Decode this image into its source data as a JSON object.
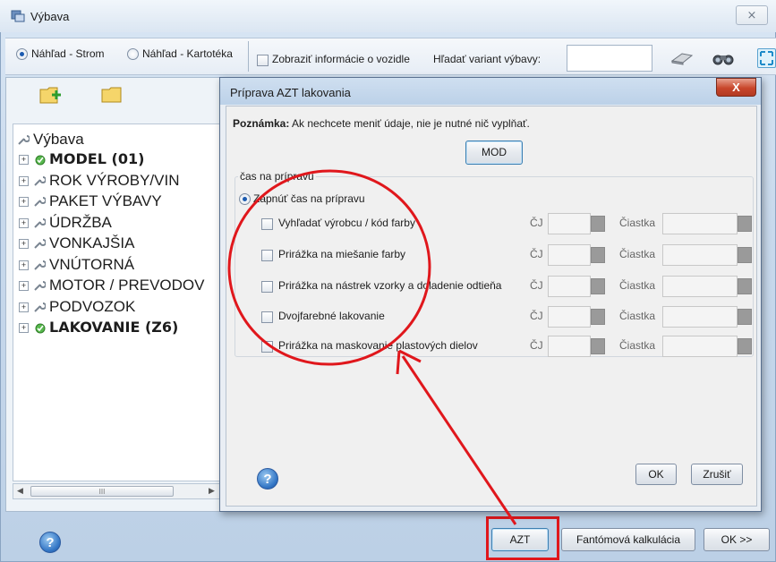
{
  "window": {
    "title": "Výbava",
    "close_glyph": "⨯"
  },
  "toolbar": {
    "view_tree": "Náhľad - Strom",
    "view_card": "Náhľad - Kartotéka",
    "show_vehicle_info": "Zobraziť informácie o vozidle",
    "find_variant": "Hľadať variant výbavy:",
    "find_value": "",
    "icons": [
      "eraser-icon",
      "binoculars-icon",
      "expand-icon"
    ]
  },
  "tree": {
    "root": "Výbava",
    "items": [
      {
        "label": "MODEL (01)",
        "bold": true
      },
      {
        "label": "ROK VÝROBY/VIN",
        "bold": false
      },
      {
        "label": "PAKET VÝBAVY",
        "bold": false
      },
      {
        "label": "ÚDRŽBA",
        "bold": false
      },
      {
        "label": "VONKAJŠIA",
        "bold": false
      },
      {
        "label": "VNÚTORNÁ",
        "bold": false
      },
      {
        "label": "MOTOR / PREVODOV",
        "bold": false
      },
      {
        "label": "PODVOZOK",
        "bold": false
      },
      {
        "label": "LAKOVANIE (Z6)",
        "bold": true
      }
    ],
    "scroll_glyph": "III"
  },
  "footer": {
    "help": "?",
    "azt": "AZT",
    "phantom": "Fantómová kalkulácia",
    "ok": "OK >>"
  },
  "dialog": {
    "title": "Príprava AZT lakovania",
    "close": "X",
    "note_bold": "Poznámka:",
    "note_text": " Ak nechcete meniť údaje, nie je nutné nič vyplňať.",
    "mod": "MOD",
    "group_title": "čas na prípravu",
    "radio_label": "Zapnúť čas na prípravu",
    "options": [
      {
        "label": "Vyhľadať výrobcu / kód farby",
        "cj": "ČJ",
        "amount": "Čiastka"
      },
      {
        "label": "Prirážka na miešanie farby",
        "cj": "ČJ",
        "amount": "Čiastka"
      },
      {
        "label": "Prirážka na nástrek vzorky a doladenie odtieňa",
        "cj": "ČJ",
        "amount": "Čiastka"
      },
      {
        "label": "Dvojfarebné lakovanie",
        "cj": "ČJ",
        "amount": "Čiastka"
      },
      {
        "label": "Prirážka na maskovanie plastových dielov",
        "cj": "ČJ",
        "amount": "Čiastka"
      }
    ],
    "help": "?",
    "ok": "OK",
    "cancel": "Zrušiť"
  },
  "colors": {
    "annotation": "#e0171c",
    "accent": "#3c7fb1"
  }
}
